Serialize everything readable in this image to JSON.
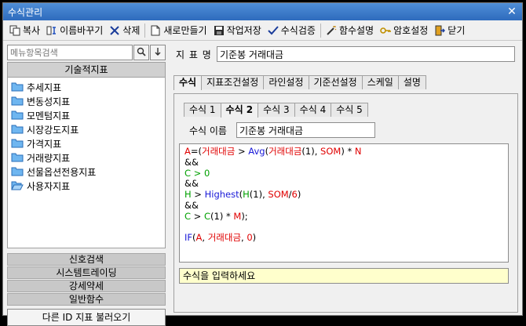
{
  "window": {
    "title": "수식관리",
    "close_glyph": "✕"
  },
  "toolbar": {
    "copy": "복사",
    "rename": "이름바꾸기",
    "delete": "삭제",
    "new": "새로만들기",
    "save": "작업저장",
    "verify": "수식검증",
    "func_help": "함수설명",
    "password": "암호설정",
    "close": "닫기"
  },
  "sidebar": {
    "search_placeholder": "메뉴항목검색",
    "category_header": "기술적지표",
    "items": [
      {
        "label": "추세지표"
      },
      {
        "label": "변동성지표"
      },
      {
        "label": "모멘텀지표"
      },
      {
        "label": "시장강도지표"
      },
      {
        "label": "가격지표"
      },
      {
        "label": "거래량지표"
      },
      {
        "label": "선물옵션전용지표"
      },
      {
        "label": "사용자지표"
      }
    ],
    "categories": [
      "신호검색",
      "시스템트레이딩",
      "강세약세",
      "일반함수"
    ],
    "load_button": "다른 ID 지표 불러오기"
  },
  "main": {
    "indicator_label": "지 표 명",
    "indicator_name": "기준봉 거래대금",
    "tabs": [
      "수식",
      "지표조건설정",
      "라인설정",
      "기준선설정",
      "스케일",
      "설명"
    ],
    "active_tab": "수식",
    "subtabs": [
      "수식 1",
      "수식 2",
      "수식 3",
      "수식 4",
      "수식 5"
    ],
    "active_subtab": "수식 2",
    "formula_name_label": "수식 이름",
    "formula_name": "기준봉 거래대금",
    "hint": "수식을 입력하세요"
  },
  "code_tokens": {
    "a": "A",
    "eq": "=(",
    "vol": "거래대금",
    "gt1": " > ",
    "avg": "Avg",
    "lp1": "(",
    "vol2": "거래대금",
    "c1": "(1), ",
    "som": "SOM",
    "rp1": ") * ",
    "n": "N",
    "amp1": "&&",
    "c_a": "C",
    "gt2": " > ",
    "zero": "0",
    "amp2": "&&",
    "h": "H",
    "gt3": " > ",
    "highest": "Highest",
    "lp2": "(",
    "h2": "H",
    "c2": "(1), ",
    "som2": "SOM",
    "slash": "/",
    "six": "6",
    "rp2": ")",
    "amp3": "&&",
    "c_b": "C",
    "gt4": " > ",
    "c_c": "C",
    "c3": "(1) * ",
    "m": "M",
    "rp3": ");",
    "if": "IF",
    "if_open": "(",
    "a2": "A",
    "comma": ", ",
    "vol3": "거래대금",
    "comma2": ", ",
    "zero2": "0",
    "if_close": ")"
  }
}
